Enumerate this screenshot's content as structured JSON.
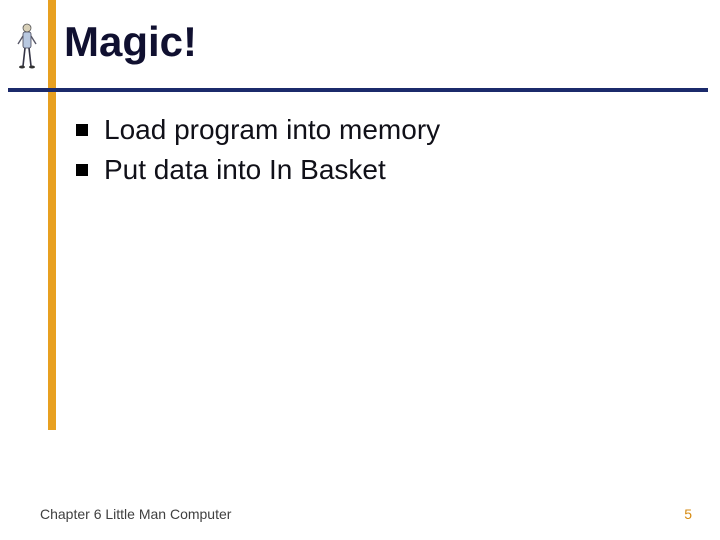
{
  "slide": {
    "title": "Magic!",
    "bullets": [
      "Load program into memory",
      "Put data into In Basket"
    ]
  },
  "footer": {
    "chapter": "Chapter 6 Little Man Computer",
    "page": "5"
  },
  "icons": {
    "decor": "little-man-figure-icon"
  }
}
